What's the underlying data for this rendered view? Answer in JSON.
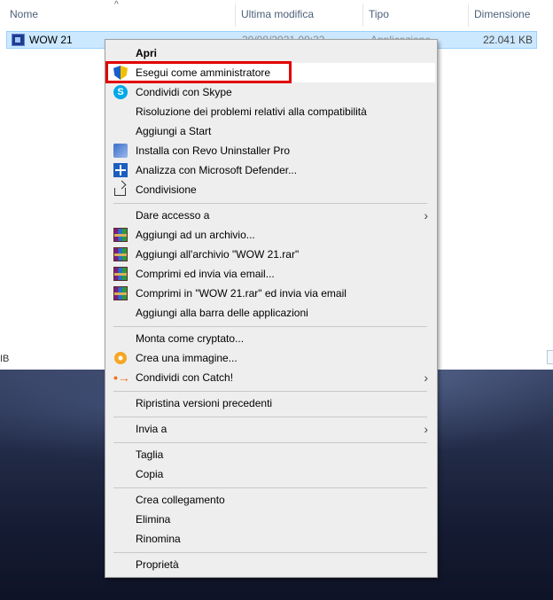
{
  "explorer": {
    "columns": {
      "name": "Nome",
      "modified": "Ultima modifica",
      "type": "Tipo",
      "size": "Dimensione"
    },
    "sort_indicator": "^",
    "file": {
      "name": "WOW 21",
      "modified": "30/08/2021 09:33",
      "type": "Applicazione",
      "size": "22.041 KB"
    },
    "left_fragment": "IB"
  },
  "context_menu": {
    "items": [
      {
        "label": "Apri",
        "icon": "",
        "bold": true
      },
      {
        "label": "Esegui come amministratore",
        "icon": "uac-shield-icon",
        "highlighted": true
      },
      {
        "label": "Condividi con Skype",
        "icon": "skype-icon"
      },
      {
        "label": "Risoluzione dei problemi relativi alla compatibilità",
        "icon": ""
      },
      {
        "label": "Aggiungi a Start",
        "icon": ""
      },
      {
        "label": "Installa con Revo Uninstaller Pro",
        "icon": "revo-uninstaller-icon"
      },
      {
        "label": "Analizza con Microsoft Defender...",
        "icon": "defender-icon"
      },
      {
        "label": "Condivisione",
        "icon": "share-icon"
      },
      {
        "label": "Dare accesso a",
        "icon": "",
        "submenu": true
      },
      {
        "label": "Aggiungi ad un archivio...",
        "icon": "winrar-icon"
      },
      {
        "label": "Aggiungi all'archivio \"WOW 21.rar\"",
        "icon": "winrar-icon"
      },
      {
        "label": "Comprimi ed invia via email...",
        "icon": "winrar-icon"
      },
      {
        "label": "Comprimi in \"WOW 21.rar\" ed invia via email",
        "icon": "winrar-icon"
      },
      {
        "label": "Aggiungi alla barra delle applicazioni",
        "icon": ""
      },
      {
        "label": "Monta come cryptato...",
        "icon": ""
      },
      {
        "label": "Crea una immagine...",
        "icon": "disc-image-icon"
      },
      {
        "label": "Condividi con Catch!",
        "icon": "catch-icon",
        "submenu": true
      },
      {
        "label": "Ripristina versioni precedenti",
        "icon": ""
      },
      {
        "label": "Invia a",
        "icon": "",
        "submenu": true
      },
      {
        "label": "Taglia",
        "icon": ""
      },
      {
        "label": "Copia",
        "icon": ""
      },
      {
        "label": "Crea collegamento",
        "icon": ""
      },
      {
        "label": "Elimina",
        "icon": ""
      },
      {
        "label": "Rinomina",
        "icon": ""
      },
      {
        "label": "Proprietà",
        "icon": ""
      }
    ],
    "submenu_glyph": "›",
    "skype_glyph": "S",
    "catch_glyph": "•→",
    "highlight_color": "#e00000"
  }
}
